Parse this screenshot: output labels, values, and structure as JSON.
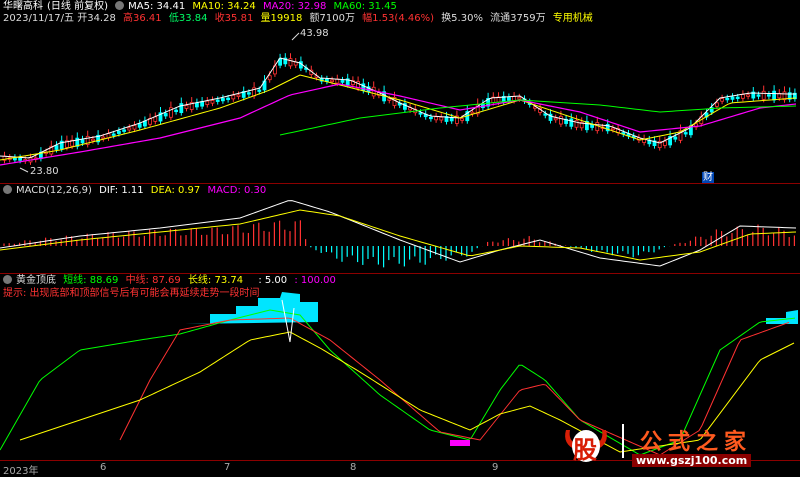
{
  "header": {
    "line1": {
      "name": "华曙高科",
      "mode": "(日线 前复权)",
      "ma5": "MA5: 34.41",
      "ma10": "MA10: 34.24",
      "ma20": "MA20: 32.98",
      "ma60": "MA60: 31.45"
    },
    "line2": {
      "date": "2023/11/17/五",
      "open": "开34.28",
      "high": "高36.41",
      "low": "低33.84",
      "close": "收35.81",
      "volume": "量19918",
      "amount": "额7100万",
      "amp": "幅1.53(4.46%)",
      "turnover": "换5.30%",
      "float": "流通3759万",
      "tag": "专用机械"
    }
  },
  "price_panel": {
    "high_label": "43.98",
    "low_label": "23.80",
    "cai_badge": "财"
  },
  "macd_panel": {
    "title": "MACD(12,26,9)",
    "dif": "DIF: 1.11",
    "dea": "DEA: 0.97",
    "macd": "MACD: 0.30"
  },
  "indicator_panel": {
    "title": "黄金顶底",
    "short": "短线: 88.69",
    "mid": "中线: 87.69",
    "long": "长线: 73.74",
    "v1": ": 5.00",
    "v2": ": 100.00",
    "tip": "提示: 出现底部和顶部信号后有可能会再延续走势一段时间"
  },
  "x_axis": [
    "2023年",
    "6",
    "7",
    "8",
    "9"
  ],
  "watermark": {
    "logo": "股",
    "text": "公式之家",
    "url": "www.gszj100.com"
  },
  "colors": {
    "up": "#ff3232",
    "down": "#00ffff",
    "ma5": "#ffffff",
    "ma10": "#ffff00",
    "ma20": "#ff00ff",
    "ma60": "#00ff00",
    "tip": "#ff3333",
    "cyan_fill": "#00e5ff"
  }
}
